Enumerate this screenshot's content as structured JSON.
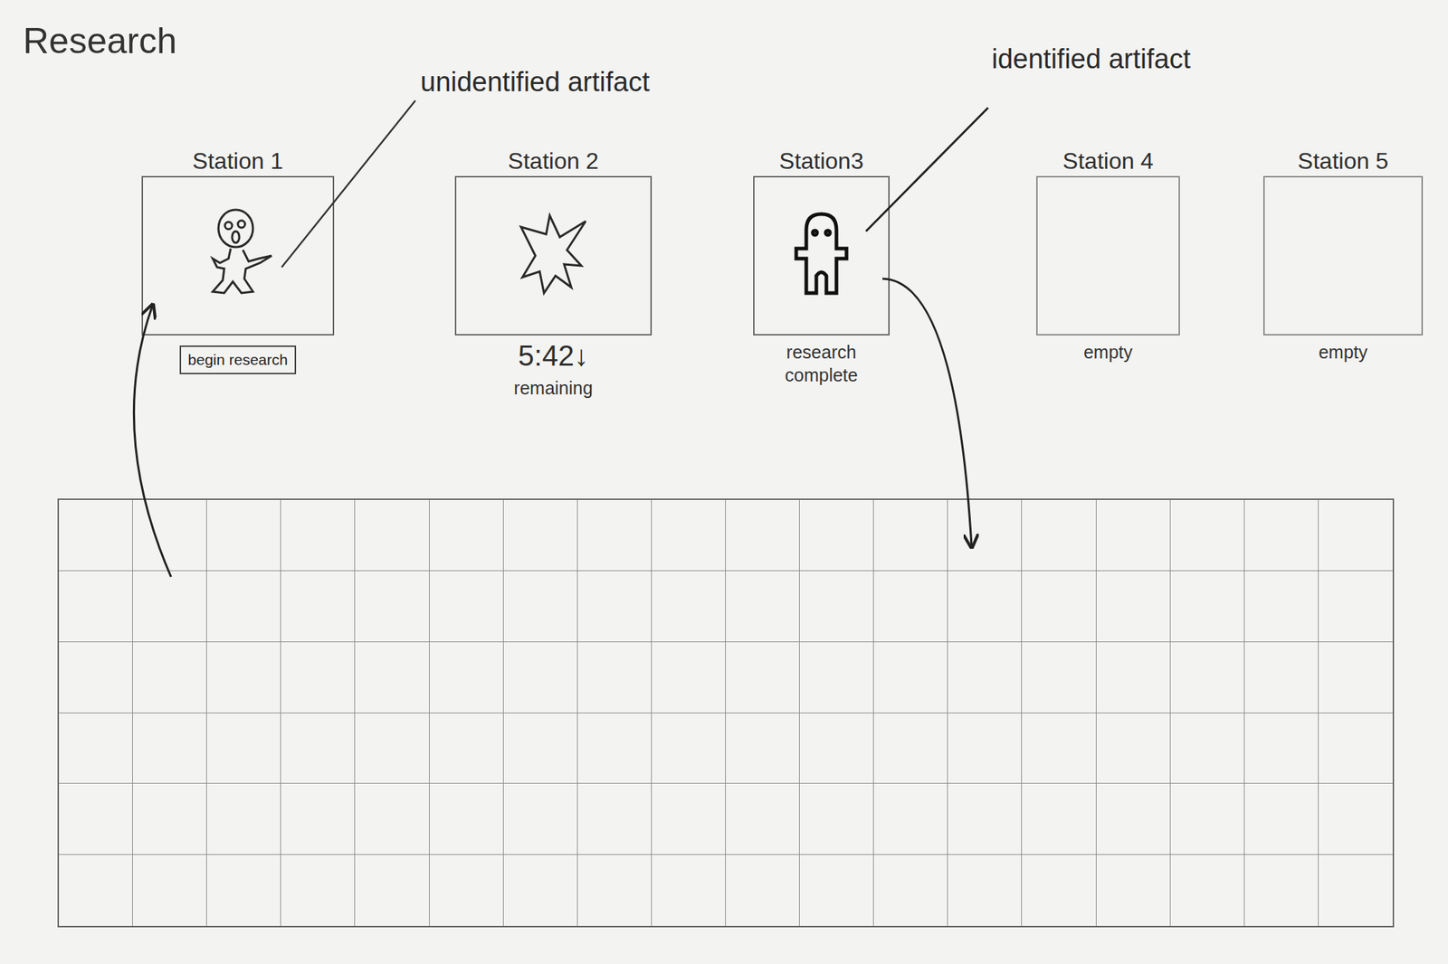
{
  "title": "Research",
  "annotations": [
    {
      "text": "unidentified artifact"
    },
    {
      "text": "identified artifact"
    }
  ],
  "stations": [
    {
      "label": "Station 1",
      "kind": "ready",
      "button": "begin research"
    },
    {
      "label": "Station 2",
      "kind": "researching",
      "time": "5:42",
      "arrow": "↓",
      "caption": "remaining"
    },
    {
      "label": "Station3",
      "kind": "complete",
      "caption": "research complete"
    },
    {
      "label": "Station 4",
      "kind": "empty",
      "caption": "empty"
    },
    {
      "label": "Station 5",
      "kind": "empty",
      "caption": "empty"
    }
  ]
}
